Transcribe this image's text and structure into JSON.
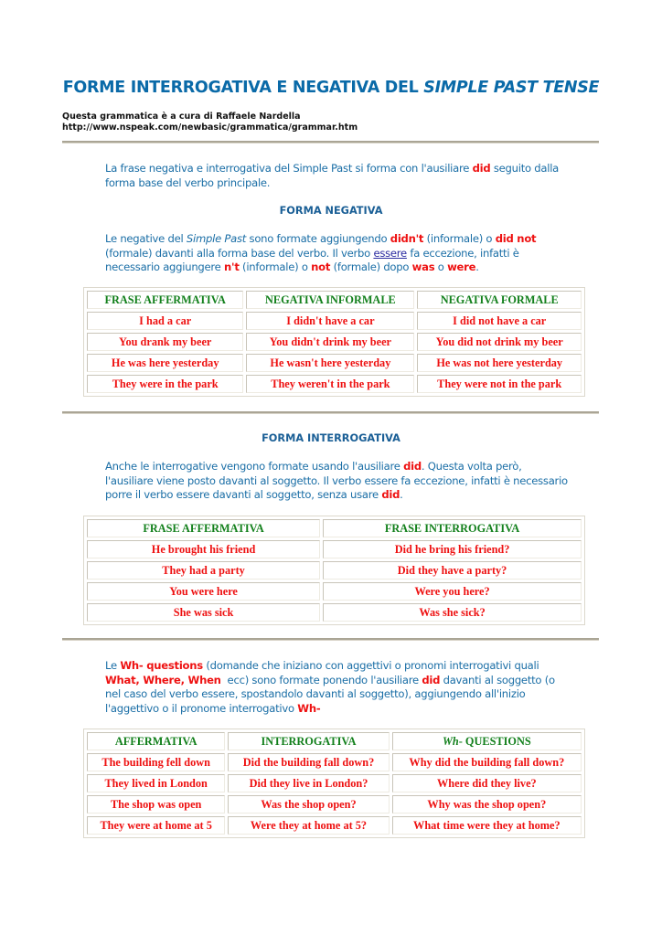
{
  "header": {
    "title_main": "FORME INTERROGATIVA E NEGATIVA DEL ",
    "title_italic": "SIMPLE PAST TENSE",
    "credit_line": "Questa grammatica è a cura di Raffaele Nardella",
    "credit_url": "http://www.nspeak.com/newbasic/grammatica/grammar.htm"
  },
  "intro": {
    "t1": "La frase negativa e interrogativa del Simple Past si forma con l'ausiliare ",
    "b1": "did",
    "t2": " seguito dalla forma base del verbo principale."
  },
  "negative": {
    "heading": "FORMA NEGATIVA",
    "p": {
      "t1": "Le negative del ",
      "i1": "Simple Past",
      "t2": " sono formate aggiungendo ",
      "b1": "didn't",
      "t3": " (informale) o ",
      "b2": "did not",
      "t4": " (formale) davanti alla forma base del verbo. Il verbo ",
      "link": "essere",
      "t5": " fa eccezione, infatti è necessario aggiungere ",
      "b3": "n't",
      "t6": " (informale) o ",
      "b4": "not",
      "t7": " (formale) dopo ",
      "b5": "was",
      "t8": " o ",
      "b6": "were",
      "t9": "."
    },
    "table": {
      "headers": [
        "FRASE AFFERMATIVA",
        "NEGATIVA INFORMALE",
        "NEGATIVA FORMALE"
      ],
      "rows": [
        [
          "I had a car",
          "I didn't have a car",
          "I did not have a car"
        ],
        [
          "You drank my beer",
          "You didn't drink my beer",
          "You did not drink my beer"
        ],
        [
          "He was here yesterday",
          "He wasn't here yesterday",
          "He was not here yesterday"
        ],
        [
          "They were in the park",
          "They weren't in the park",
          "They were not in the park"
        ]
      ]
    }
  },
  "interrogative": {
    "heading": "FORMA INTERROGATIVA",
    "p": {
      "t1": "Anche le interrogative vengono formate usando l'ausiliare ",
      "b1": "did",
      "t2": ". Questa volta però, l'ausiliare viene posto davanti al soggetto. Il verbo essere fa eccezione, infatti è necessario porre il verbo essere davanti al soggetto, senza usare ",
      "b2": "did",
      "t3": "."
    },
    "table": {
      "headers": [
        "FRASE AFFERMATIVA",
        "FRASE INTERROGATIVA"
      ],
      "rows": [
        [
          "He brought his friend",
          "Did he bring his friend?"
        ],
        [
          "They had a party",
          "Did they have a party?"
        ],
        [
          "You were here",
          "Were you here?"
        ],
        [
          "She was sick",
          "Was she sick?"
        ]
      ]
    }
  },
  "wh": {
    "p": {
      "t1": "Le ",
      "b1": "Wh- questions",
      "t2": " (domande che iniziano con aggettivi o pronomi interrogativi quali ",
      "b2": "What, Where, When",
      "t3": "  ecc) sono formate ponendo l'ausiliare ",
      "b3": "did",
      "t4": " davanti al soggetto (o nel caso del verbo essere, spostandolo davanti al soggetto), aggiungendo all'inizio l'aggettivo o il pronome interrogativo ",
      "b4": "Wh-"
    },
    "table": {
      "headers": [
        "AFFERMATIVA",
        "INTERROGATIVA",
        "- QUESTIONS"
      ],
      "header3_italic": "Wh",
      "rows": [
        [
          "The building fell down",
          "Did the building fall down?",
          "Why did the building fall down?"
        ],
        [
          "They lived in London",
          "Did they live in London?",
          "Where did they live?"
        ],
        [
          "The shop was open",
          "Was the shop open?",
          "Why was the shop open?"
        ],
        [
          "They were at home at 5",
          "Were they at home at 5?",
          "What time were they at home?"
        ]
      ]
    }
  }
}
